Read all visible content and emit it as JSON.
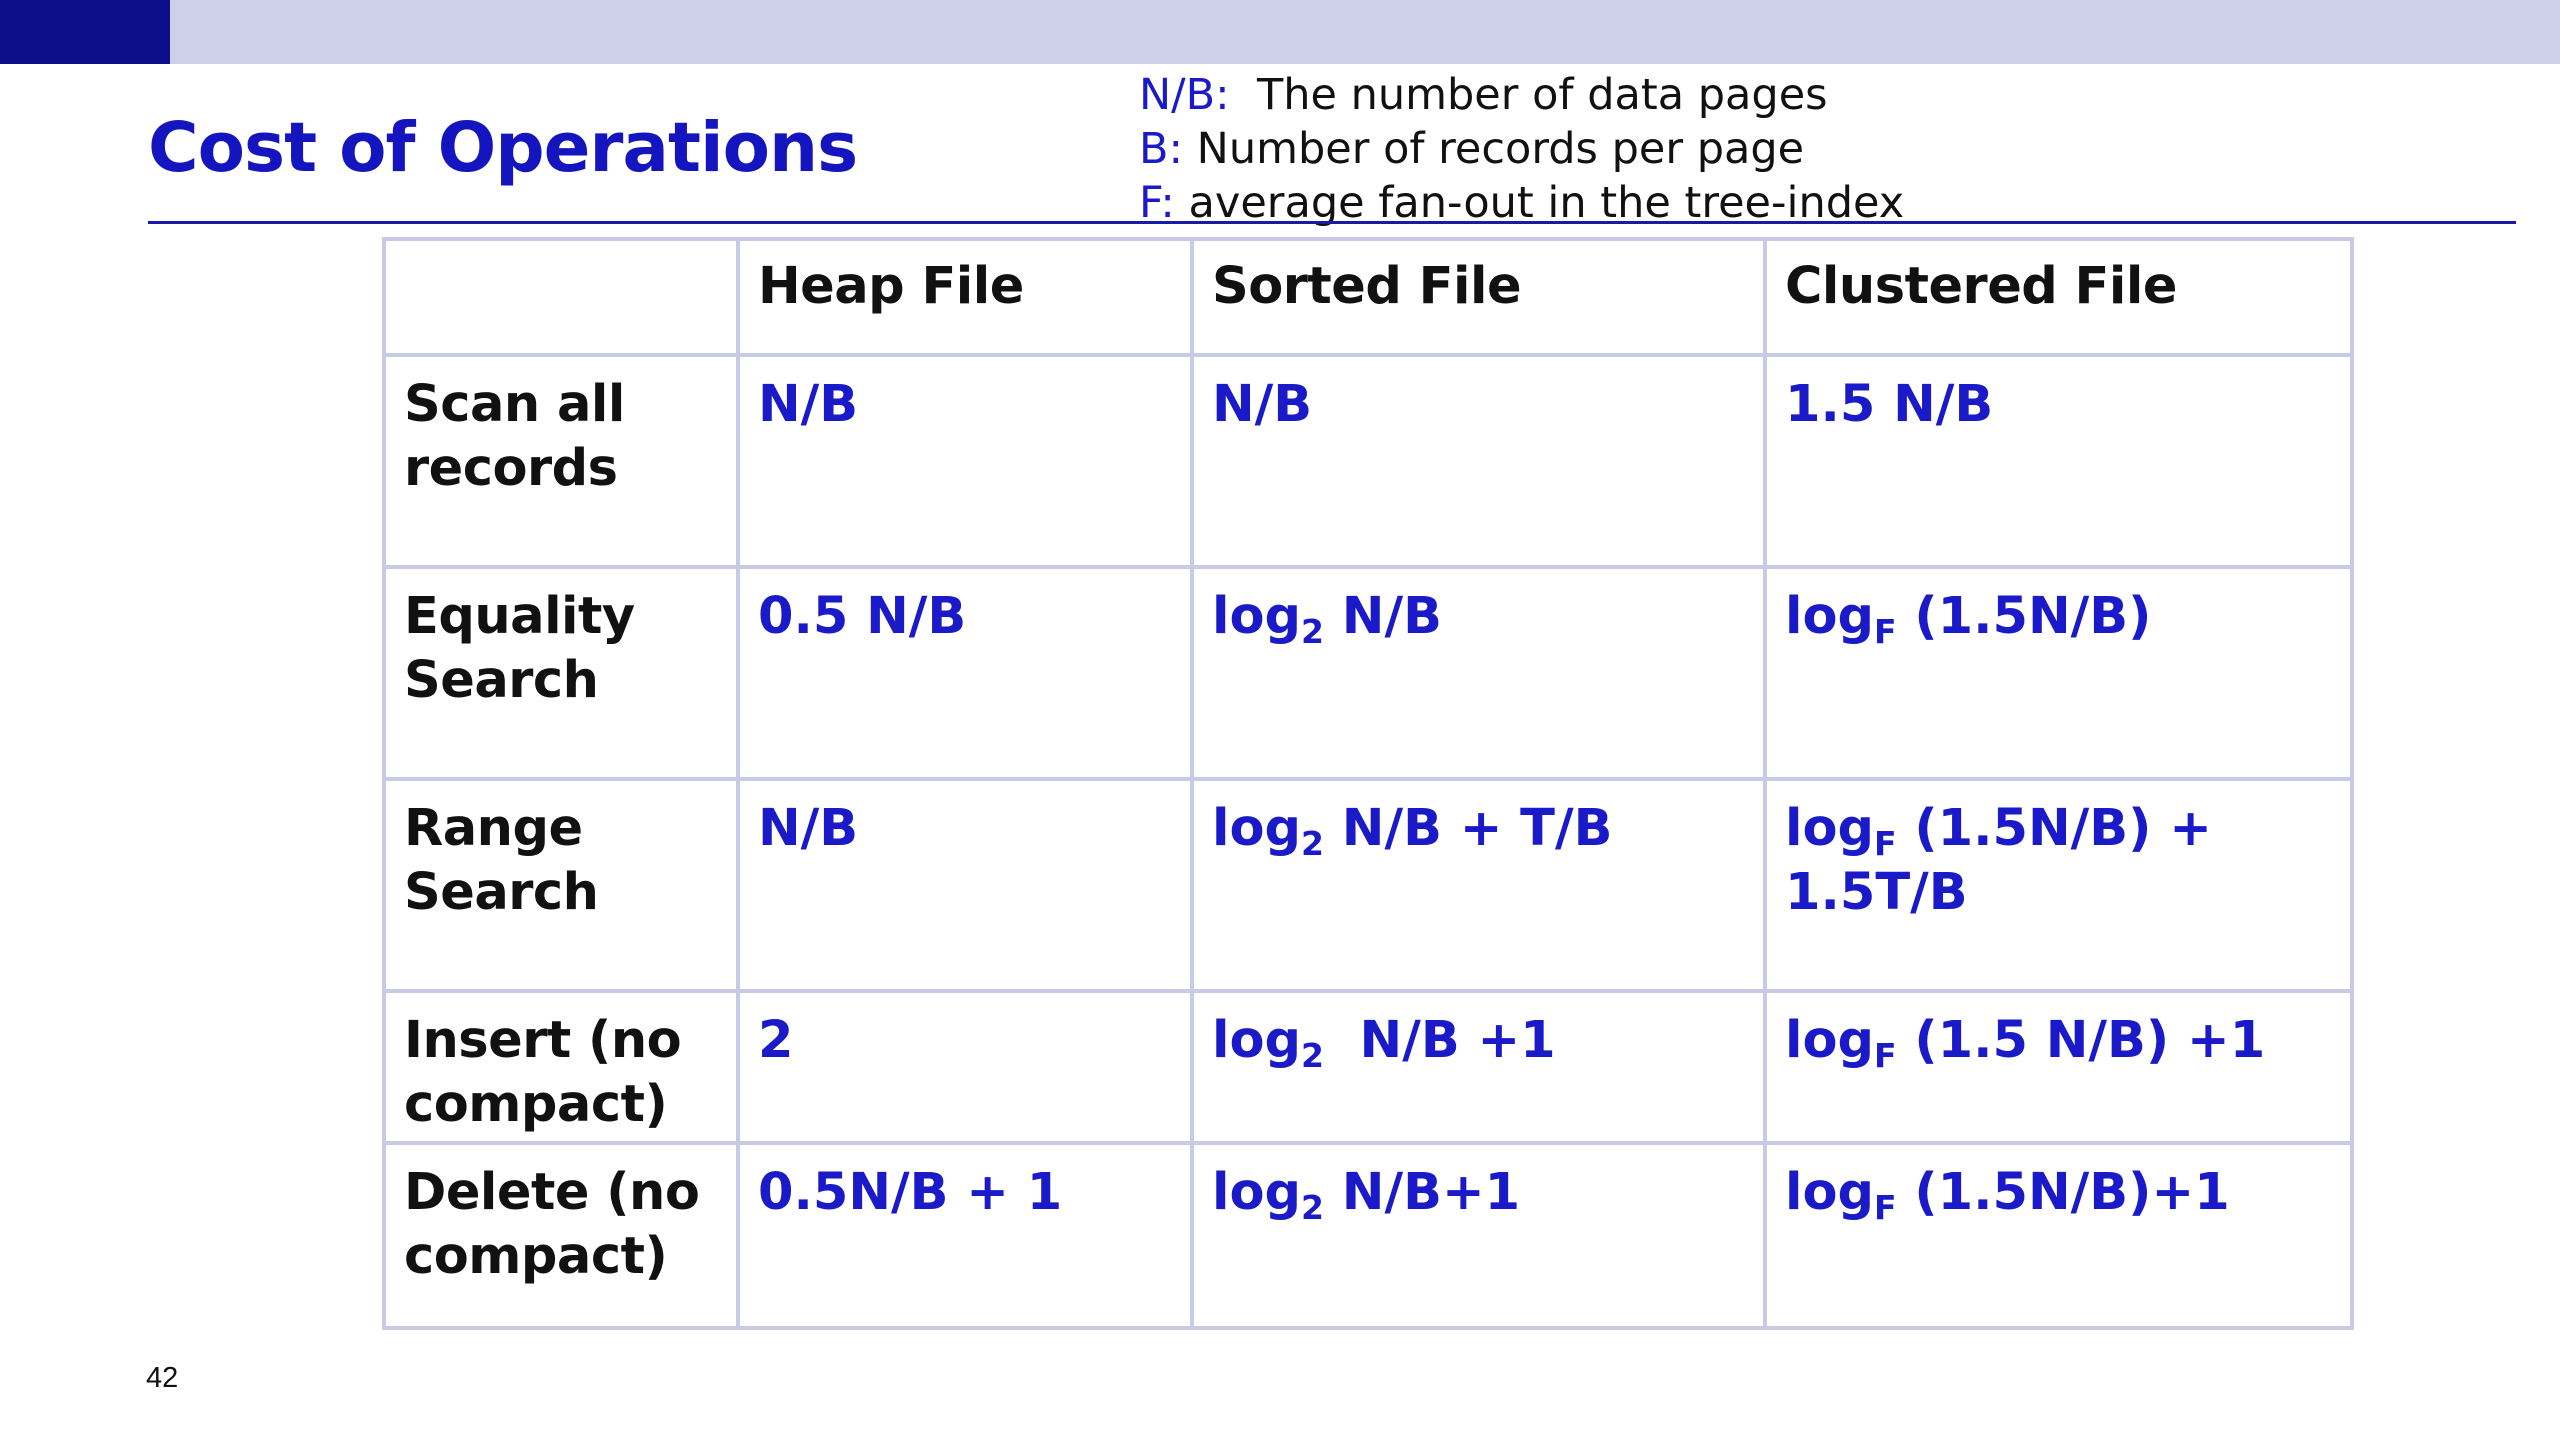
{
  "slide": {
    "title": "Cost of Operations",
    "page_number": "42",
    "colors": {
      "title": "#1515c0",
      "top_bar": "#cdd0e8",
      "top_bar_accent": "#0b0f8a",
      "cost_text": "#1a1ac8",
      "table_border": "#c9cbe6"
    }
  },
  "legend": [
    {
      "key": "N/B:",
      "text": "  The number of data pages"
    },
    {
      "key": "B:",
      "text": " Number of records per page"
    },
    {
      "key": "F:",
      "text": " average fan-out in the tree-index"
    }
  ],
  "table": {
    "headers": [
      "",
      "Heap File",
      "Sorted File",
      "Clustered File"
    ],
    "rows": [
      {
        "operation": [
          "Scan all",
          "records"
        ],
        "heap": {
          "pre": "N/B"
        },
        "sorted": {
          "pre": "N/B"
        },
        "clustered": {
          "pre": "1.5 N/B"
        }
      },
      {
        "operation": [
          "Equality",
          "Search"
        ],
        "heap": {
          "pre": "0.5 N/B"
        },
        "sorted": {
          "pre": "log",
          "sub": "2",
          "post": " N/B"
        },
        "clustered": {
          "pre": "log",
          "sub": "F",
          "post": " (1.5N/B)"
        }
      },
      {
        "operation": [
          "Range",
          "Search"
        ],
        "heap": {
          "pre": "N/B"
        },
        "sorted": {
          "pre": "log",
          "sub": "2",
          "post": " N/B + T/B"
        },
        "clustered": {
          "pre": "log",
          "sub": "F",
          "post": " (1.5N/B) +",
          "line2": "1.5T/B"
        }
      },
      {
        "operation": [
          "Insert (no",
          "compact)"
        ],
        "heap": {
          "pre": "2"
        },
        "sorted": {
          "pre": "log",
          "sub": "2",
          "post": "  N/B +1"
        },
        "clustered": {
          "pre": "log",
          "sub": "F",
          "post": " (1.5 N/B) +1"
        }
      },
      {
        "operation": [
          "Delete (no",
          "compact)"
        ],
        "heap": {
          "pre": "0.5N/B + 1"
        },
        "sorted": {
          "pre": "log",
          "sub": "2",
          "post": " N/B+1"
        },
        "clustered": {
          "pre": "log",
          "sub": "F",
          "post": " (1.5N/B)+1"
        }
      }
    ]
  }
}
